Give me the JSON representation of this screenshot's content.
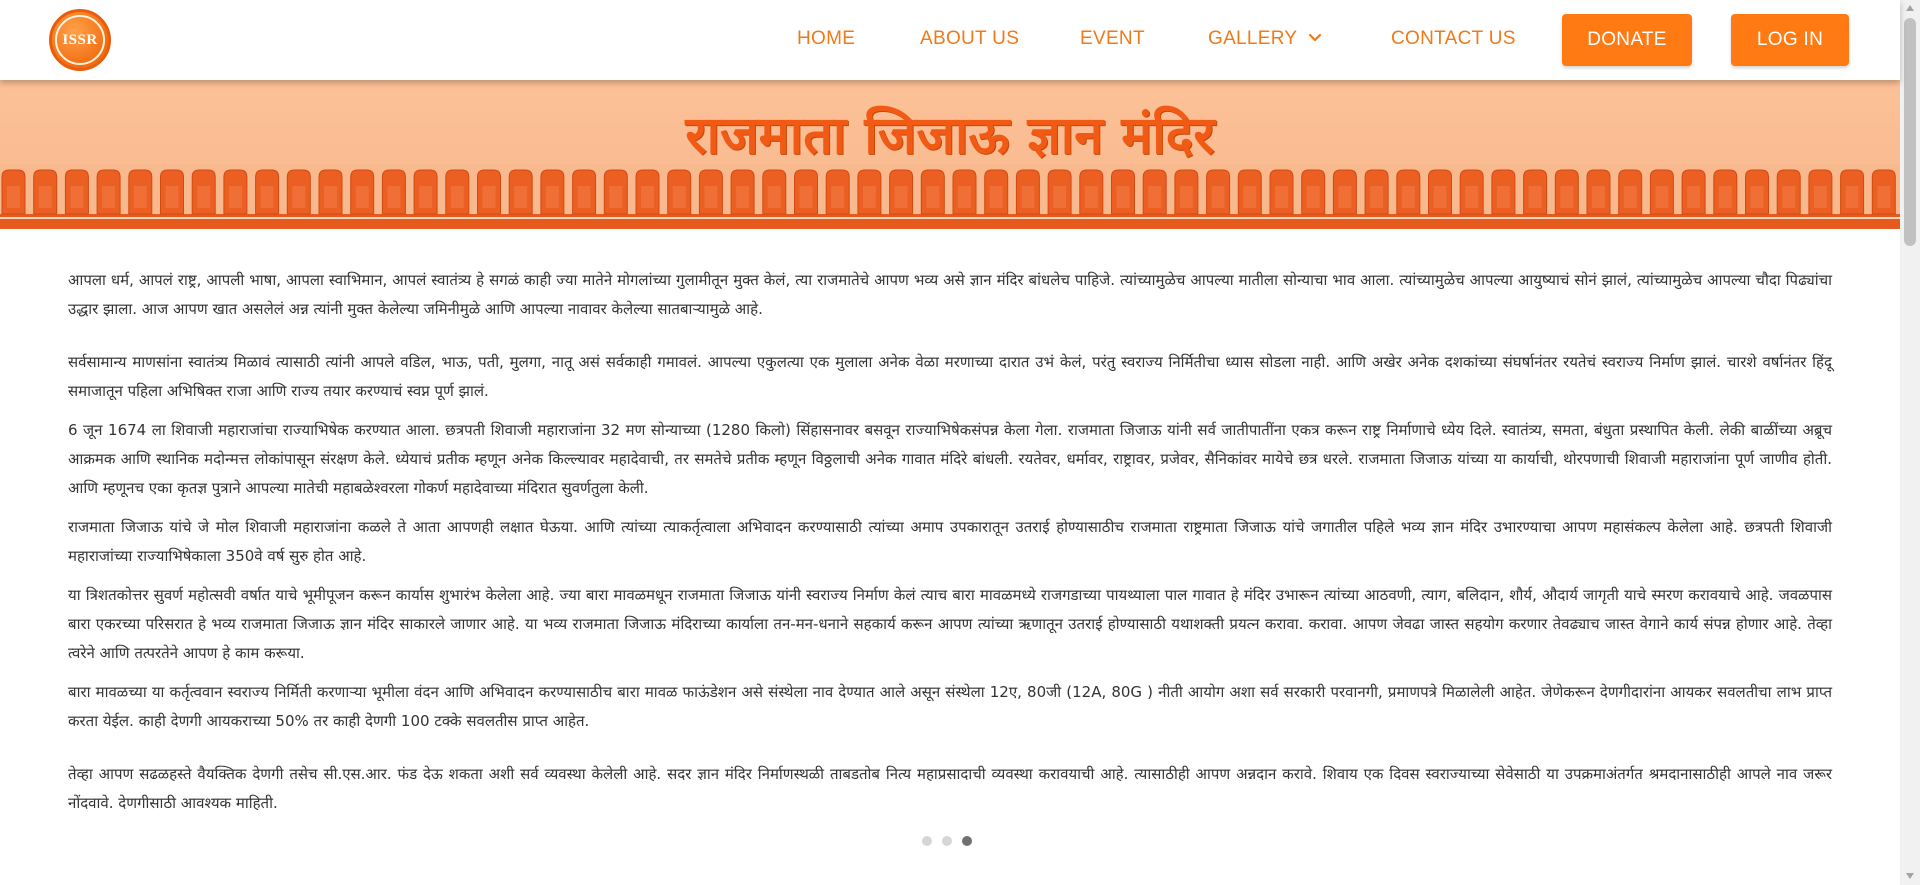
{
  "logo": {
    "text": "ISSR"
  },
  "nav": {
    "home": "HOME",
    "about": "ABOUT US",
    "event": "EVENT",
    "gallery": "GALLERY",
    "contact": "CONTACT US",
    "donate": "DONATE",
    "login": "LOG IN"
  },
  "icons": {
    "gallery_dropdown": "chevron-down-icon"
  },
  "banner": {
    "title": "राजमाता जिजाऊ ज्ञान मंदिर"
  },
  "content": {
    "paragraphs": [
      "आपला धर्म, आपलं राष्ट्र, आपली भाषा, आपला स्वाभिमान, आपलं स्वातंत्र्य हे सगळं काही ज्या मातेने मोगलांच्या गुलामीतून मुक्त केलं, त्या राजमातेचे आपण भव्य असे ज्ञान मंदिर बांधलेच पाहिजे. त्यांच्यामुळेच आपल्या मातीला सोन्याचा भाव आला. त्यांच्यामुळेच आपल्या आयुष्याचं सोनं झालं, त्यांच्यामुळेच आपल्या चौदा पिढ्यांचा उद्धार झाला. आज आपण खात असलेलं अन्न त्यांनी मुक्त केलेल्या जमिनीमुळे आणि आपल्या नावावर केलेल्या सातबाऱ्यामुळे आहे.",
      "सर्वसामान्य माणसांना स्वातंत्र्य मिळावं त्यासाठी त्यांनी आपले वडिल, भाऊ, पती, मुलगा, नातू असं सर्वकाही गमावलं. आपल्या एकुलत्या एक मुलाला अनेक वेळा मरणाच्या दारात उभं केलं, परंतु स्वराज्य निर्मितीचा ध्यास सोडला नाही. आणि अखेर अनेक दशकांच्या संघर्षानंतर रयतेचं स्वराज्य निर्माण झालं. चारशे वर्षानंतर हिंदू समाजातून पहिला अभिषिक्त राजा आणि राज्य तयार करण्याचं स्वप्न पूर्ण झालं.",
      "6 जून 1674 ला शिवाजी महाराजांचा राज्याभिषेक करण्यात आला. छत्रपती शिवाजी महाराजांना 32 मण सोन्याच्या (1280 किलो) सिंहासनावर बसवून राज्याभिषेकसंपन्न केला गेला. राजमाता जिजाऊ यांनी सर्व जातीपातींना एकत्र करून राष्ट्र निर्माणाचे ध्येय दिले. स्वातंत्र्य, समता, बंधुता प्रस्थापित केली. लेकी बाळींच्या अब्रूच आक्रमक आणि स्थानिक मदोन्मत्त लोकांपासून संरक्षण केले. ध्येयाचं प्रतीक म्हणून अनेक किल्ल्यावर महादेवाची, तर समतेचे प्रतीक म्हणून विठ्ठलाची अनेक गावात मंदिरे बांधली. रयतेवर, धर्मावर, राष्ट्रावर, प्रजेवर, सैनिकांवर मायेचे छत्र धरले. राजमाता जिजाऊ यांच्या या कार्याची, थोरपणाची शिवाजी महाराजांना पूर्ण जाणीव होती. आणि म्हणूनच एका कृतज्ञ पुत्राने आपल्या मातेची महाबळेश्वरला गोकर्ण महादेवाच्या मंदिरात सुवर्णतुला केली.",
      "राजमाता जिजाऊ यांचे जे मोल शिवाजी महाराजांना कळले ते आता आपणही लक्षात घेऊया. आणि त्यांच्या त्याकर्तृत्वाला अभिवादन करण्यासाठी त्यांच्या अमाप उपकारातून उतराई होण्यासाठीच राजमाता राष्ट्रमाता जिजाऊ यांचे जगातील पहिले भव्य ज्ञान मंदिर उभारण्याचा आपण महासंकल्प केलेला आहे. छत्रपती शिवाजी महाराजांच्या राज्याभिषेकाला 350वे वर्ष सुरु होत आहे.",
      "या त्रिशतकोत्तर सुवर्ण महोत्सवी वर्षात याचे भूमीपूजन करून कार्यास शुभारंभ केलेला आहे. ज्या बारा मावळमधून राजमाता जिजाऊ यांनी स्वराज्य निर्माण केलं त्याच बारा मावळमध्ये राजगडाच्या पायथ्याला पाल गावात हे मंदिर उभारून त्यांच्या आठवणी, त्याग, बलिदान, शौर्य, औदार्य जागृती याचे स्मरण करावयाचे आहे. जवळपास बारा एकरच्या परिसरात हे भव्य राजमाता जिजाऊ ज्ञान मंदिर साकारले जाणार आहे. या भव्य राजमाता जिजाऊ मंदिराच्या कार्याला तन-मन-धनाने सहकार्य करून आपण त्यांच्या ऋणातून उतराई होण्यासाठी यथाशक्ती प्रयत्न करावा. करावा. आपण जेवढा जास्त सहयोग करणार तेवढ्याच जास्त वेगाने कार्य संपन्न होणार आहे. तेव्हा त्वरेने आणि तत्परतेने आपण हे काम करूया.",
      "बारा मावळच्या या कर्तृत्ववान स्वराज्य निर्मिती करणाऱ्या भूमीला वंदन आणि अभिवादन करण्यासाठीच बारा मावळ फाऊंडेशन असे संस्थेला नाव देण्यात आले असून संस्थेला 12ए, 80जी (12A, 80G ) नीती आयोग अशा सर्व सरकारी परवानगी, प्रमाणपत्रे मिळालेली आहेत. जेणेकरून देणगीदारांना आयकर सवलतीचा लाभ प्राप्त करता येईल. काही देणगी आयकराच्या 50% तर काही देणगी 100 टक्के सवलतीस प्राप्त आहेत.",
      "तेव्हा आपण सढळहस्ते वैयक्तिक देणगी तसेच सी.एस.आर. फंड देऊ शकता अशी सर्व व्यवस्था केलेली आहे. सदर ज्ञान मंदिर निर्माणस्थळी ताबडतोब नित्य महाप्रसादाची व्यवस्था करावयाची आहे. त्यासाठीही आपण अन्नदान करावे. शिवाय एक दिवस स्वराज्याच्या सेवेसाठी या उपक्रमाअंतर्गत श्रमदानासाठीही आपले नाव जरूर नोंदवावे. देणगीसाठी आवश्यक माहिती."
    ]
  },
  "carousel": {
    "count": 3,
    "active": 3
  },
  "colors": {
    "accent": "#ff7a12",
    "title": "#f05a14",
    "banner_bg": "#fcc197"
  }
}
